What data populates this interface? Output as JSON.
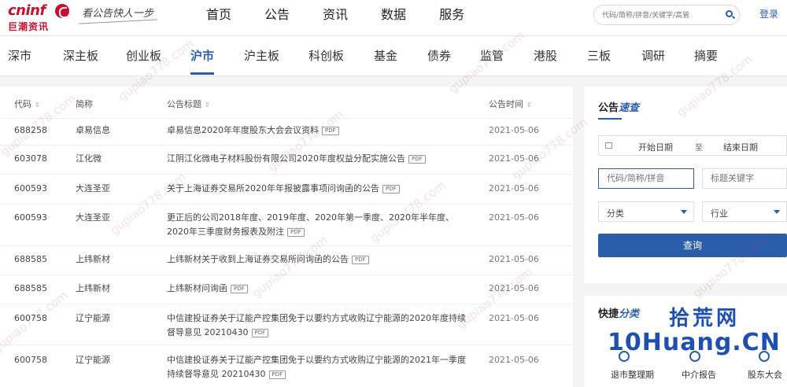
{
  "header": {
    "logo_text": "cninf",
    "logo_cn": "巨潮资讯",
    "slogan": "看公告快人一步",
    "nav": [
      "首页",
      "公告",
      "资讯",
      "数据",
      "服务"
    ],
    "search_placeholder": "代码/简称/拼音/关键字/高管",
    "login": "登录"
  },
  "categories": [
    "深市",
    "深主板",
    "创业板",
    "沪市",
    "沪主板",
    "科创板",
    "基金",
    "债券",
    "监管",
    "港股",
    "三板",
    "调研",
    "摘要"
  ],
  "active_category": "沪市",
  "table": {
    "headers": {
      "code": "代码",
      "name": "简称",
      "title": "公告标题",
      "time": "公告时间"
    },
    "sort_glyph": "⇕",
    "pdf_label": "PDF",
    "rows": [
      {
        "code": "688258",
        "name": "卓易信息",
        "title": "卓易信息2020年年度股东大会会议资料",
        "date": "2021-05-06"
      },
      {
        "code": "603078",
        "name": "江化微",
        "title": "江阴江化微电子材料股份有限公司2020年度权益分配实施公告",
        "date": "2021-05-06"
      },
      {
        "code": "600593",
        "name": "大连圣亚",
        "title": "关于上海证券交易所2020年年报披露事项问询函的公告",
        "date": "2021-05-06"
      },
      {
        "code": "600593",
        "name": "大连圣亚",
        "title": "更正后的公司2018年度、2019年度、2020年第一季度、2020年半年度、2020年三季度财务报表及附注",
        "date": "2021-05-06"
      },
      {
        "code": "688585",
        "name": "上纬新材",
        "title": "上纬新材关于收到上海证券交易所问询函的公告",
        "date": "2021-05-06"
      },
      {
        "code": "688585",
        "name": "上纬新材",
        "title": "上纬新材问询函",
        "date": "2021-05-06"
      },
      {
        "code": "600758",
        "name": "辽宁能源",
        "title": "中信建投证券关于辽能产控集团免于以要约方式收购辽宁能源的2020年度持续督导意见 20210430",
        "date": "2021-05-06"
      },
      {
        "code": "600758",
        "name": "辽宁能源",
        "title": "中信建投证券关于辽能产控集团免于以要约方式收购辽宁能源的2021年一季度持续督导意见 20210430",
        "date": "2021-05-06"
      }
    ]
  },
  "quick_search": {
    "title_a": "公告",
    "title_b": "速查",
    "start_date": "开始日期",
    "to": "至",
    "end_date": "结束日期",
    "code_placeholder": "代码/简称/拼音",
    "keyword_placeholder": "标题关键字",
    "category": "分类",
    "industry": "行业",
    "button": "查询"
  },
  "shortcut": {
    "title_a": "快捷",
    "title_b": "分类",
    "items": [
      "退市整理期",
      "中介报告",
      "股东大会"
    ]
  },
  "watermark": {
    "text": "gupiao778.com",
    "brand_top": "拾荒网",
    "brand_bottom": "10Huang.CN"
  }
}
